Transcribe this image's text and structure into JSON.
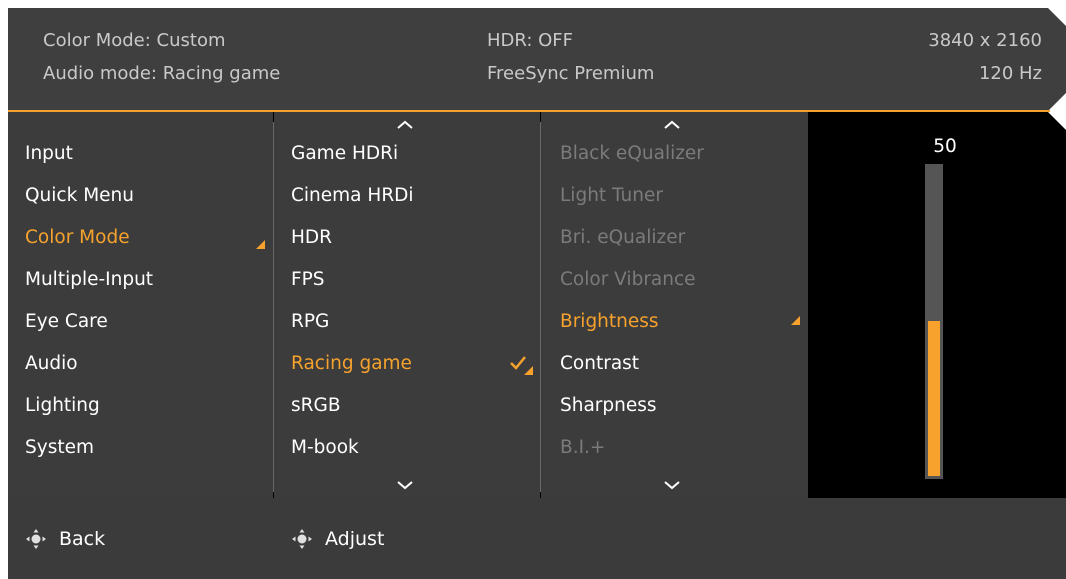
{
  "header": {
    "color_mode": "Color Mode: Custom",
    "audio_mode": "Audio mode: Racing game",
    "hdr": "HDR: OFF",
    "freesync": "FreeSync Premium",
    "resolution": "3840 x 2160",
    "refresh": "120 Hz"
  },
  "menu": {
    "items": [
      {
        "label": "Input",
        "state": "normal"
      },
      {
        "label": "Quick Menu",
        "state": "normal"
      },
      {
        "label": "Color Mode",
        "state": "active"
      },
      {
        "label": "Multiple-Input",
        "state": "normal"
      },
      {
        "label": "Eye Care",
        "state": "normal"
      },
      {
        "label": "Audio",
        "state": "normal"
      },
      {
        "label": "Lighting",
        "state": "normal"
      },
      {
        "label": "System",
        "state": "normal"
      }
    ]
  },
  "modes": {
    "items": [
      {
        "label": "Game HDRi",
        "state": "normal"
      },
      {
        "label": "Cinema HRDi",
        "state": "normal"
      },
      {
        "label": "HDR",
        "state": "normal"
      },
      {
        "label": "FPS",
        "state": "normal"
      },
      {
        "label": "RPG",
        "state": "normal"
      },
      {
        "label": "Racing game",
        "state": "active",
        "checked": true
      },
      {
        "label": "sRGB",
        "state": "normal"
      },
      {
        "label": "M-book",
        "state": "normal"
      }
    ]
  },
  "settings": {
    "items": [
      {
        "label": "Black eQualizer",
        "state": "dim"
      },
      {
        "label": "Light Tuner",
        "state": "dim"
      },
      {
        "label": "Bri. eQualizer",
        "state": "dim"
      },
      {
        "label": "Color Vibrance",
        "state": "dim"
      },
      {
        "label": "Brightness",
        "state": "active"
      },
      {
        "label": "Contrast",
        "state": "normal"
      },
      {
        "label": "Sharpness",
        "state": "normal"
      },
      {
        "label": "B.I.+",
        "state": "dim"
      }
    ]
  },
  "slider": {
    "value_label": "50",
    "level_percent": 50
  },
  "footer": {
    "back_label": "Back",
    "adjust_label": "Adjust"
  },
  "colors": {
    "accent": "#f6a22d",
    "panel": "#3c3c3c",
    "header": "#3f3f3f",
    "dim_text": "#7b7b7b"
  },
  "icons": {
    "scroll_up": "chevron-up-icon",
    "scroll_down": "chevron-down-icon",
    "selected": "check-icon",
    "submenu": "corner-triangle-icon",
    "control": "joystick-icon"
  }
}
